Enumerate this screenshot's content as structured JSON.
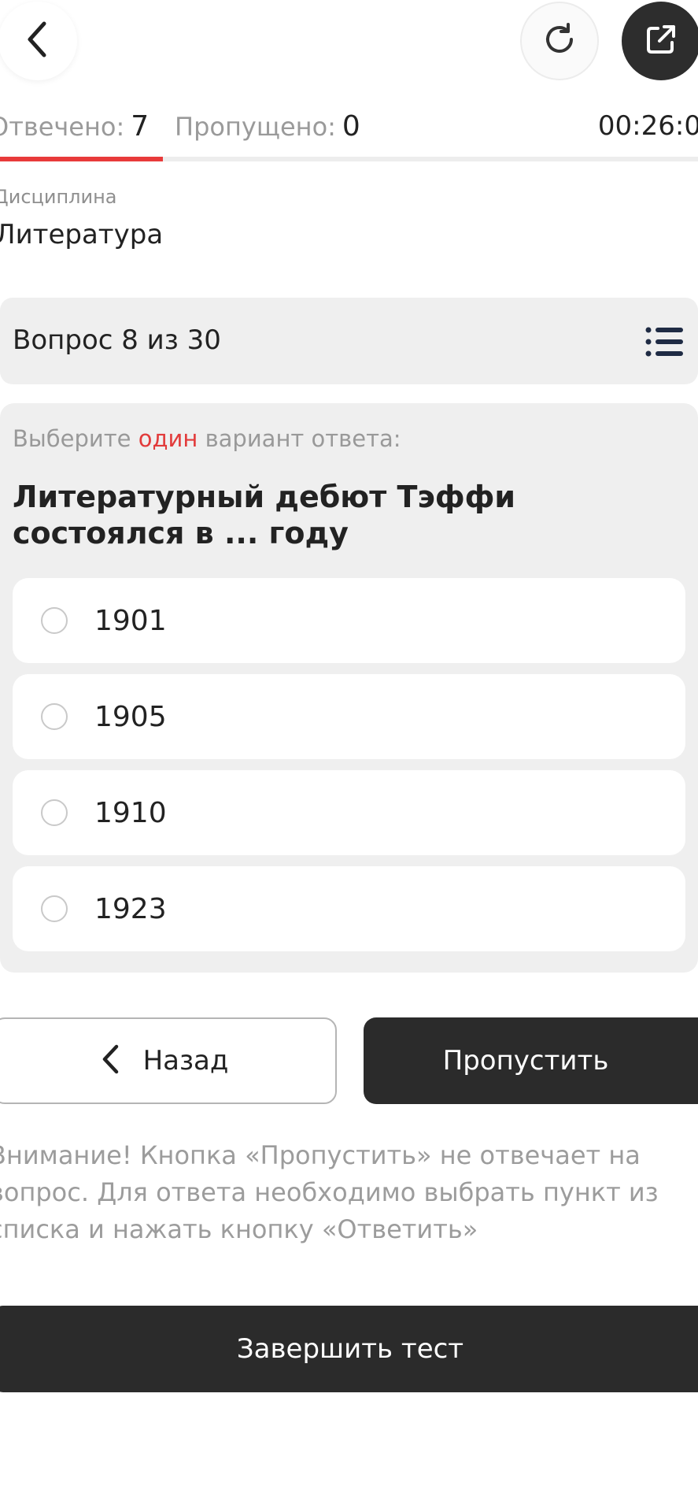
{
  "header": {
    "answered_label": "Отвечено:",
    "answered_count": "7",
    "skipped_label": "Пропущено:",
    "skipped_count": "0",
    "timer": "00:26:0",
    "progress": 0.233
  },
  "discipline": {
    "label": "Дисциплина",
    "value": "Литература"
  },
  "question_bar": {
    "text": "Вопрос 8 из 30"
  },
  "question": {
    "instruction_pre": "Выберите",
    "instruction_highlight": "один",
    "instruction_post": "вариант ответа:",
    "text": "Литературный дебют Тэффи состоялся в ... году",
    "options": [
      "1901",
      "1905",
      "1910",
      "1923"
    ]
  },
  "buttons": {
    "back": "Назад",
    "skip": "Пропустить",
    "finish": "Завершить тест"
  },
  "warning": "Внимание! Кнопка «Пропустить» не отвечает на вопрос. Для ответа необходимо выбрать пункт из списка и нажать кнопку «Ответить»",
  "colors": {
    "accent_red": "#e83a3a",
    "dark_button": "#2b2b2b"
  }
}
